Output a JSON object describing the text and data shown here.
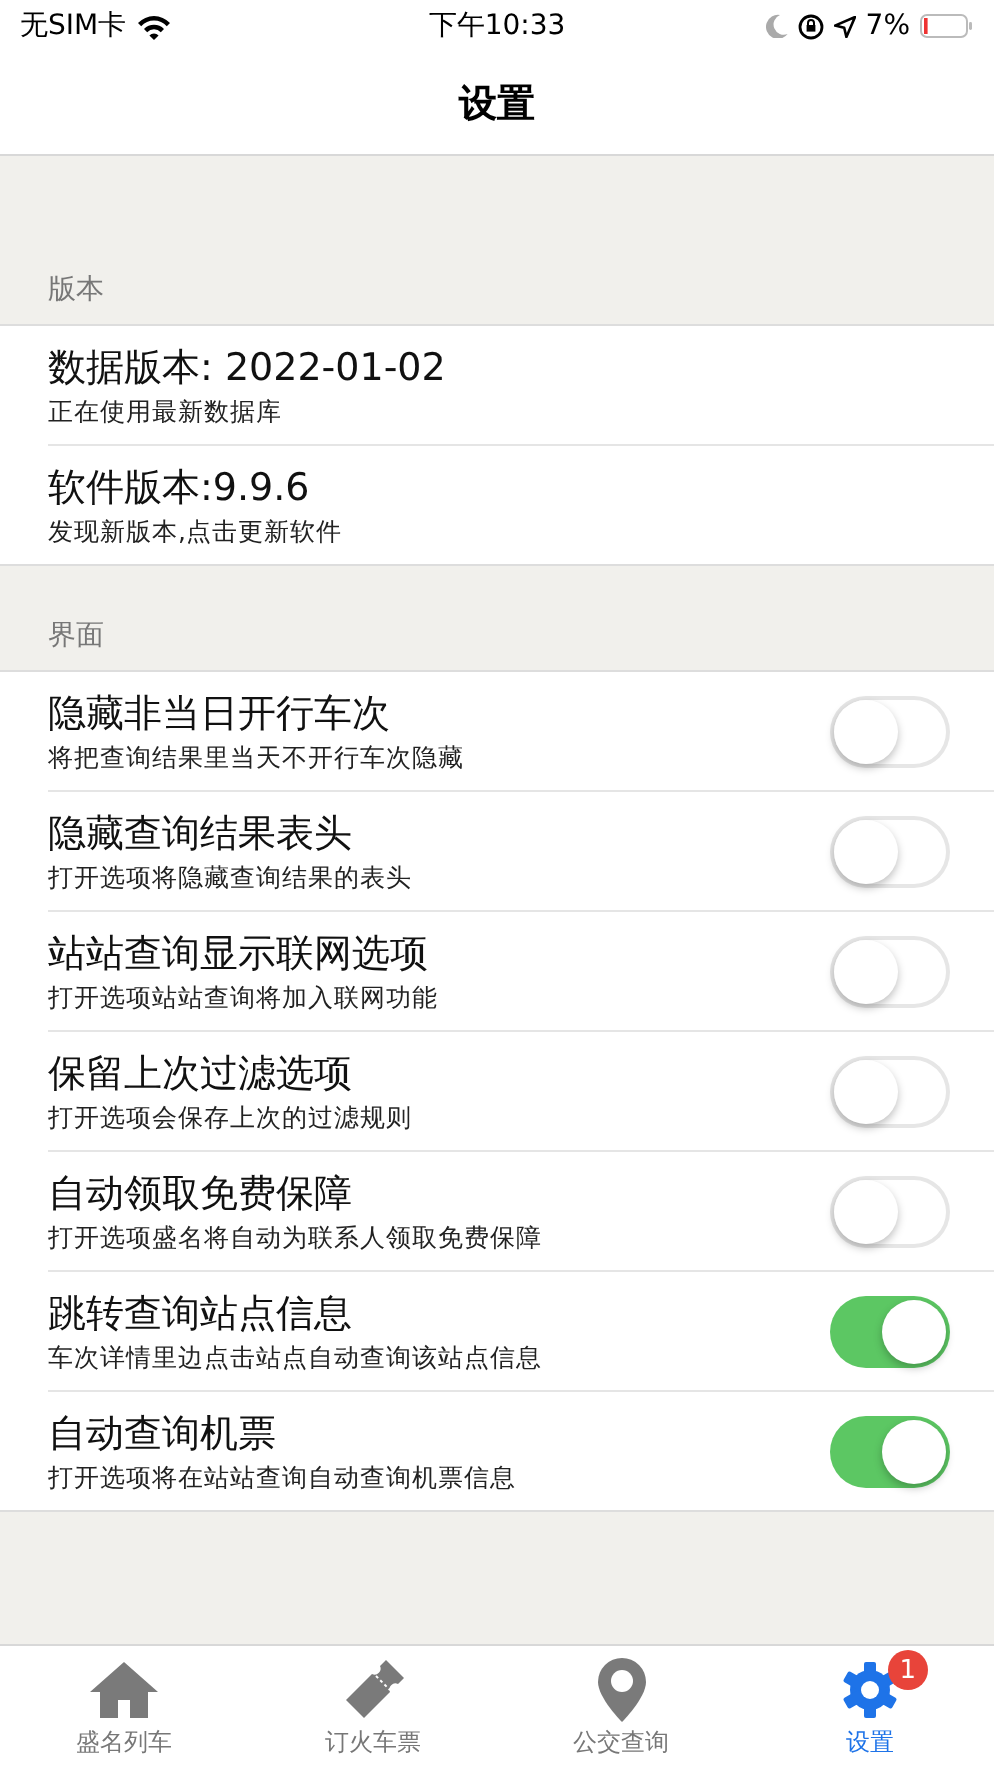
{
  "status_bar": {
    "carrier": "无SIM卡",
    "time": "下午10:33",
    "battery": "7%"
  },
  "nav": {
    "title": "设置"
  },
  "sections": [
    {
      "header": "版本",
      "rows": [
        {
          "kind": "info",
          "title": "数据版本: 2022-01-02",
          "subtitle": "正在使用最新数据库"
        },
        {
          "kind": "info",
          "title": "软件版本:9.9.6",
          "subtitle": "发现新版本,点击更新软件"
        }
      ]
    },
    {
      "header": "界面",
      "rows": [
        {
          "kind": "toggle",
          "title": "隐藏非当日开行车次",
          "subtitle": "将把查询结果里当天不开行车次隐藏",
          "on": false
        },
        {
          "kind": "toggle",
          "title": "隐藏查询结果表头",
          "subtitle": "打开选项将隐藏查询结果的表头",
          "on": false
        },
        {
          "kind": "toggle",
          "title": "站站查询显示联网选项",
          "subtitle": "打开选项站站查询将加入联网功能",
          "on": false
        },
        {
          "kind": "toggle",
          "title": "保留上次过滤选项",
          "subtitle": "打开选项会保存上次的过滤规则",
          "on": false
        },
        {
          "kind": "toggle",
          "title": "自动领取免费保障",
          "subtitle": "打开选项盛名将自动为联系人领取免费保障",
          "on": false
        },
        {
          "kind": "toggle",
          "title": "跳转查询站点信息",
          "subtitle": "车次详情里边点击站点自动查询该站点信息",
          "on": true
        },
        {
          "kind": "toggle",
          "title": "自动查询机票",
          "subtitle": "打开选项将在站站查询自动查询机票信息",
          "on": true
        }
      ]
    }
  ],
  "tab_bar": [
    {
      "label": "盛名列车",
      "kind": "house",
      "selected": false
    },
    {
      "label": "订火车票",
      "kind": "ticket",
      "selected": false
    },
    {
      "label": "公交查询",
      "kind": "pin",
      "selected": false
    },
    {
      "label": "设置",
      "kind": "gear",
      "selected": true,
      "badge": "1"
    }
  ]
}
